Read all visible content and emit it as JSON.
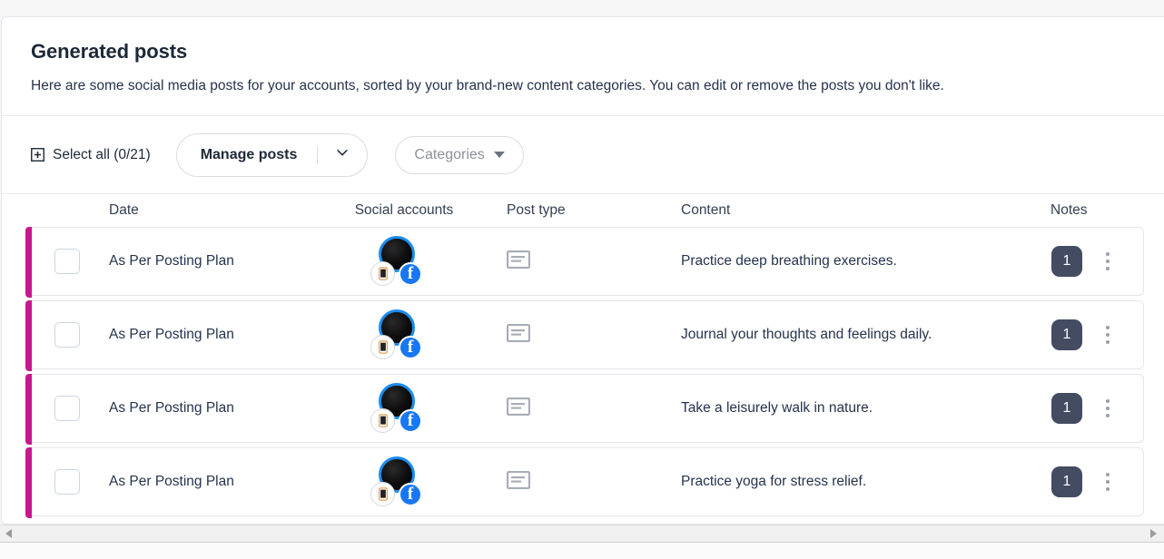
{
  "card": {
    "title": "Generated posts",
    "subtitle": "Here are some social media posts for your accounts, sorted by your brand-new content categories. You can edit or remove the posts you don't like."
  },
  "toolbar": {
    "select_all_label": "Select all (0/21)",
    "select_all_icon": "plus-square-icon",
    "manage_posts_label": "Manage posts",
    "manage_posts_caret_icon": "chevron-down-icon",
    "categories_label": "Categories",
    "categories_caret_icon": "caret-down-icon"
  },
  "table": {
    "headers": {
      "date": "Date",
      "social_accounts": "Social accounts",
      "post_type": "Post type",
      "content": "Content",
      "notes": "Notes"
    },
    "accent_color": "#c9168f",
    "note_badge_color": "#434c61",
    "facebook_color": "#1877f2",
    "rows": [
      {
        "date": "As Per Posting Plan",
        "social_accounts": [
          "mobile-icon",
          "facebook-icon"
        ],
        "post_type_icon": "text-post-icon",
        "content": "Practice deep breathing exercises.",
        "notes": "1",
        "menu_icon": "kebab-menu-icon"
      },
      {
        "date": "As Per Posting Plan",
        "social_accounts": [
          "mobile-icon",
          "facebook-icon"
        ],
        "post_type_icon": "text-post-icon",
        "content": "Journal your thoughts and feelings daily.",
        "notes": "1",
        "menu_icon": "kebab-menu-icon"
      },
      {
        "date": "As Per Posting Plan",
        "social_accounts": [
          "mobile-icon",
          "facebook-icon"
        ],
        "post_type_icon": "text-post-icon",
        "content": "Take a leisurely walk in nature.",
        "notes": "1",
        "menu_icon": "kebab-menu-icon"
      },
      {
        "date": "As Per Posting Plan",
        "social_accounts": [
          "mobile-icon",
          "facebook-icon"
        ],
        "post_type_icon": "text-post-icon",
        "content": "Practice yoga for stress relief.",
        "notes": "1",
        "menu_icon": "kebab-menu-icon"
      }
    ]
  },
  "scrollbar": {
    "left_arrow_icon": "scroll-left-arrow-icon",
    "right_arrow_icon": "scroll-right-arrow-icon"
  }
}
